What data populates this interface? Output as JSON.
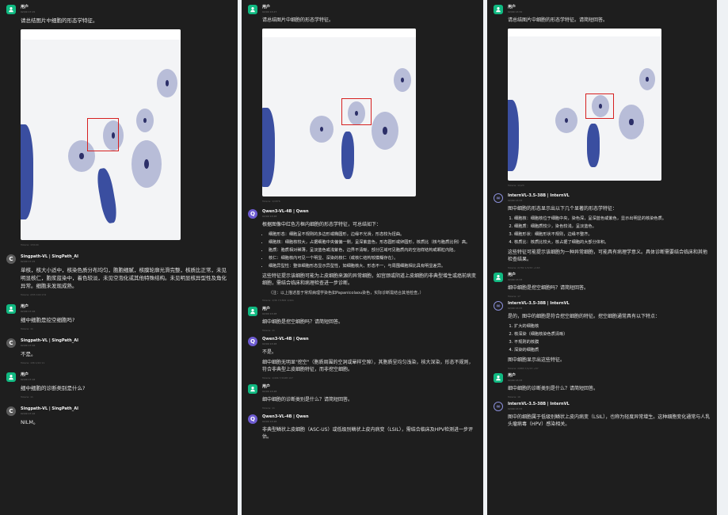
{
  "icons": {
    "user": "user-icon",
    "singpath": "letter-c-avatar",
    "qwen": "qwen-logo",
    "internvl": "internvl-logo"
  },
  "colors": {
    "background": "#1e1e1e",
    "user_avatar": "#10b981",
    "red_box": "#d62020"
  },
  "p1": {
    "user1": {
      "name": "用户",
      "time": "02/09 17:15",
      "text": "请总结图片中细胞的形态学特征。",
      "tokens": "Tokens: 13/100"
    },
    "bot1": {
      "name": "Singpath-VL | SingPath_AI",
      "time": "02/09 17:15",
      "text": "单核，核大小适中，核染色质分布均匀，胞胞细腻，核膜轮廓光滑完整，核质比正常，未见明显核仁，胞浆蓝染中，着色较淡，未见空泡化或其他特殊结构。未见明显核异型性及角化异常。细胞未发现成熟。",
      "tokens": "Tokens: 2/55  100  174"
    },
    "user2": {
      "name": "用户",
      "time": "02/09 17:16",
      "text": "细中细胞是挖空细胞吗?",
      "tokens": "Tokens: 11"
    },
    "bot2": {
      "name": "Singpath-VL | SingPath_AI",
      "time": "02/09 17:16",
      "text": "不是。",
      "tokens": "Tokens: 136  1/22  11"
    },
    "user3": {
      "name": "用户",
      "time": "02/09 17:16",
      "text": "细中细胞的诊断类别是什么?",
      "tokens": "Tokens: 11"
    },
    "bot3": {
      "name": "Singpath-VL | SingPath_AI",
      "time": "02/09 17:16",
      "text": "NILM。"
    }
  },
  "p2": {
    "user1": {
      "name": "用户",
      "time": "02/09 13:27",
      "text": "请总结图片中细胞的形态学特征。",
      "tokens": "Tokens: 1/1876"
    },
    "bot1": {
      "name": "Qwen3-VL-4B | Qwen",
      "time": "02/09 13:28",
      "intro": "根据图像中红色方框内细胞的形态学特征，可总结如下：",
      "bullets": [
        "细胞形态：细胞呈不规则的多边形或椭圆形，边缘不光滑，形态较为扭曲。",
        "细胞核：细胞核较大，占据细胞中央偏偏一侧，呈深紫蓝色，形态圆形或卵圆形，核质比（核与胞质比例）高。",
        "胞质：胞质相对稀薄，呈淡蓝色或浅紫色，边界不清晰，部分区域可见胞质内的空泡样结构或颗粒内陷。",
        "核仁：细胞核内可见一个明显、深染的核仁（或核仁结构较模糊存在）。",
        "细胞异型性：整体细胞形态显示异型性，如细胞核大、形态不一，与周围细胞相比具有明显差异。"
      ],
      "summary": "这些特征提示该细胞可能为上皮细胞来源的异常细胞，如宫颈或阴道上皮细胞的非典型增生或癌前病变细胞，需结合临床和病理检查进一步诊断。",
      "note": "（注：以上描述基于常规病理学染色如Papanicolaou染色，实际诊断需结合其他检查。）",
      "tokens": "Tokens: 1/36  7/1806  1/401"
    },
    "user2": {
      "name": "用户",
      "time": "02/09 13:28",
      "text": "细中细胞是挖空细胞吗？请简短回答。",
      "tokens": "Tokens: 11"
    },
    "bot2": {
      "name": "Qwen3-VL-4B | Qwen",
      "time": "02/09 13:28",
      "text1": "不是。",
      "text2": "细中细胞无明显\"挖空\"（胞质周围的空洞或晕样空隙），其胞质呈均匀浅染，核大深染，形态不规则，符合非典型上皮细胞特征，而非挖空细胞。",
      "tokens": "Tokens: 1/49b  7/1948  107"
    },
    "user3": {
      "name": "用户",
      "time": "02/09 13:28",
      "text": "细中细胞的诊断类别是什么？请简短回答。",
      "tokens": "Tokens: 11"
    },
    "bot3": {
      "name": "Qwen3-VL-4B | Qwen",
      "time": "02/09 13:28",
      "text": "非典型鳞状上皮细胞（ASC-US）或低级别鳞状上皮内病变（LSIL），需结合临床及HPV检测进一步评估。"
    }
  },
  "p3": {
    "user1": {
      "name": "用户",
      "time": "02/09 13:32",
      "text": "请总结图片中细胞的形态学特征。请简短回答。",
      "tokens": "Tokens: 11/23"
    },
    "bot1": {
      "name": "InternVL-3.5-38B | InternVL",
      "time": "02/09 13:33",
      "intro": "图中细胞的形态显示出以下几个显著的形态学特征：",
      "items": [
        "细胞核：细胞核位于细胞中央，染色深，呈深蓝色或紫色，显示出明显的核染色质。",
        "细胞质：细胞质较少，染色较浅，呈淡蓝色。",
        "细胞形状：细胞形状不规则，边缘不整齐。",
        "核质比：核质比较大，核占据了细胞的大部分体积。"
      ],
      "summary": "这些特征可能提示该细胞为一种异常细胞，可能具有病理学意义。具体诊断需要结合临床和其他检查结果。",
      "tokens": "Tokens: 2/782  1/3/33  +163"
    },
    "user2": {
      "name": "用户",
      "time": "02/09 13:33",
      "text": "细中细胞是挖空细胞吗？请简短回答。",
      "tokens": "Tokens: 17"
    },
    "bot2": {
      "name": "InternVL-3.5-38B | InternVL",
      "time": "02/09 13:33",
      "intro": "是的，图中的细胞是符合挖空细胞的特征。挖空细胞通常具有以下特点：",
      "items": [
        "扩大的细胞核",
        "核深染（细胞核染色质清晰）",
        "不规则的核膜",
        "深染的细胞质"
      ],
      "summary": "图中细胞显示出这些特征。",
      "tokens": "Tokens: 2/883  7/1/13  +87"
    },
    "user3": {
      "name": "用户",
      "time": "02/09 13:33",
      "text": "细中细胞的诊断类别是什么？请简短回答。",
      "tokens": "Tokens: 16"
    },
    "bot3": {
      "name": "InternVL-3.5-38B | InternVL",
      "time": "02/09 13:33",
      "text": "图中的细胞属于低级别鳞状上皮内病变（LSIL），也称为轻度异常增生。这种细胞变化通常与人乳头瘤病毒（HPV）感染相关。"
    }
  }
}
